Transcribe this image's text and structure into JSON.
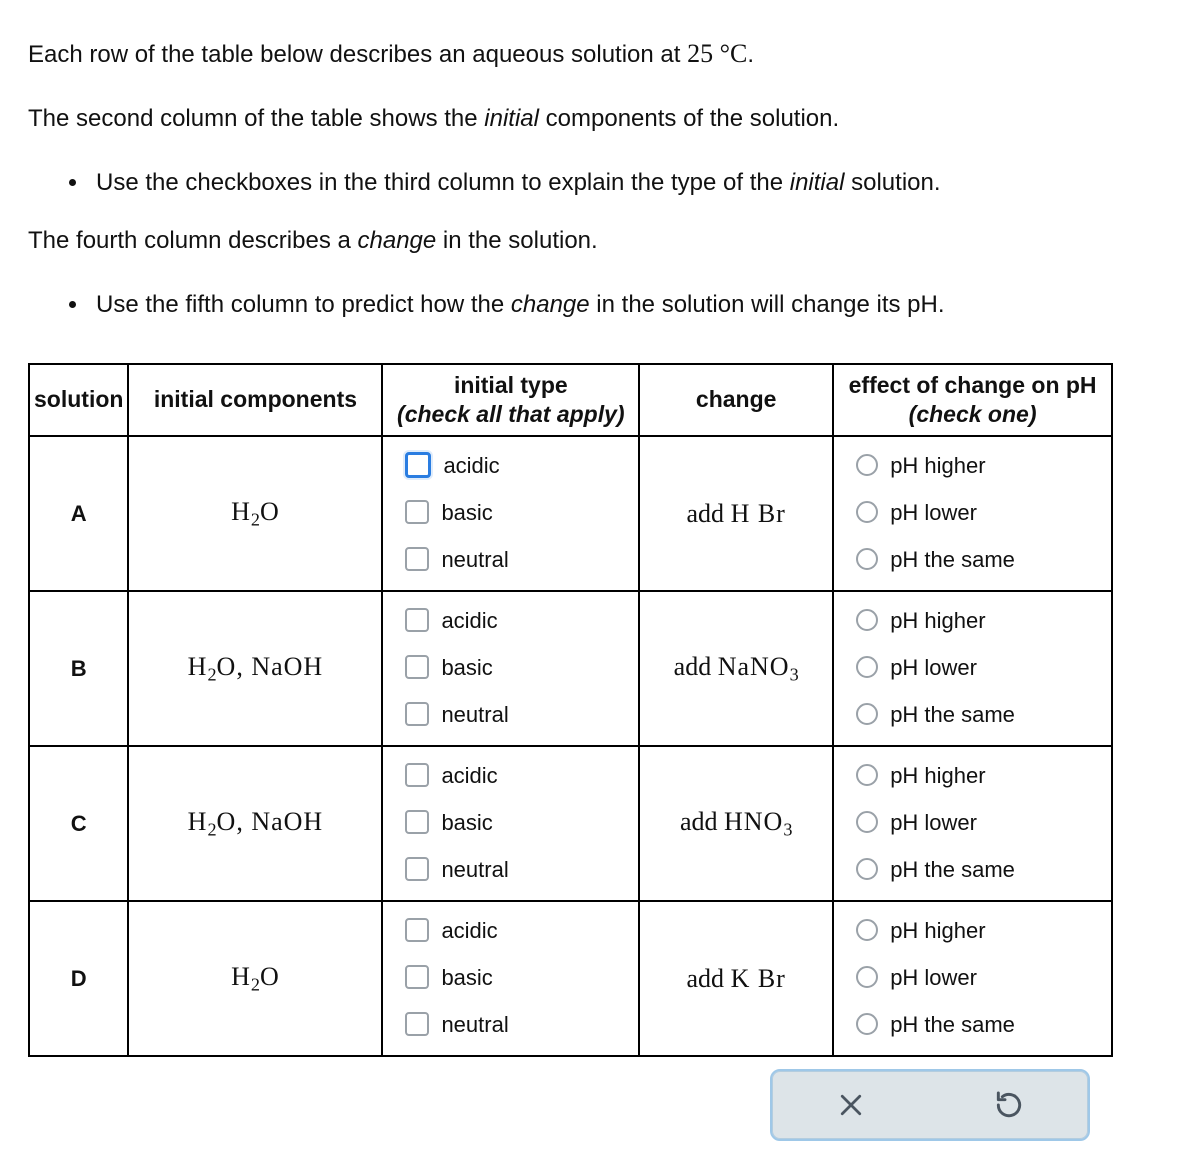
{
  "intro": {
    "line1_a": "Each row of the table below describes an aqueous solution at ",
    "line1_temp": "25 °C",
    "line1_b": ".",
    "line2_a": "The second column of the table shows the ",
    "line2_i": "initial",
    "line2_b": " components of the solution.",
    "bullet1_a": "Use the checkboxes in the third column to explain the type of the ",
    "bullet1_i": "initial",
    "bullet1_b": " solution.",
    "line3_a": "The fourth column describes a ",
    "line3_i": "change",
    "line3_b": " in the solution.",
    "bullet2_a": "Use the fifth column to predict how the ",
    "bullet2_i": "change",
    "bullet2_b": " in the solution will change its pH."
  },
  "headers": {
    "solution": "solution",
    "components": "initial components",
    "type_main": "initial type",
    "type_sub": "(check all that apply)",
    "change": "change",
    "effect_main": "effect of change on pH",
    "effect_sub": "(check one)"
  },
  "type_options": {
    "acidic": "acidic",
    "basic": "basic",
    "neutral": "neutral"
  },
  "effect_options": {
    "higher": "pH higher",
    "lower": "pH lower",
    "same": "pH the same"
  },
  "rows": {
    "A": {
      "id": "A",
      "change_prefix": "add "
    },
    "B": {
      "id": "B",
      "change_prefix": "add "
    },
    "C": {
      "id": "C",
      "change_prefix": "add "
    },
    "D": {
      "id": "D",
      "change_prefix": "add "
    }
  },
  "chart_data": {
    "type": "table",
    "title": "Aqueous solutions at 25 °C — initial type and effect of change on pH",
    "columns": [
      "solution",
      "initial components",
      "initial type (check all that apply)",
      "change",
      "effect of change on pH (check one)"
    ],
    "type_choices": [
      "acidic",
      "basic",
      "neutral"
    ],
    "effect_choices": [
      "pH higher",
      "pH lower",
      "pH the same"
    ],
    "rows": [
      {
        "solution": "A",
        "initial_components": "H2O",
        "change": "add HBr"
      },
      {
        "solution": "B",
        "initial_components": "H2O, NaOH",
        "change": "add NaNO3"
      },
      {
        "solution": "C",
        "initial_components": "H2O, NaOH",
        "change": "add HNO3"
      },
      {
        "solution": "D",
        "initial_components": "H2O",
        "change": "add KBr"
      }
    ]
  }
}
